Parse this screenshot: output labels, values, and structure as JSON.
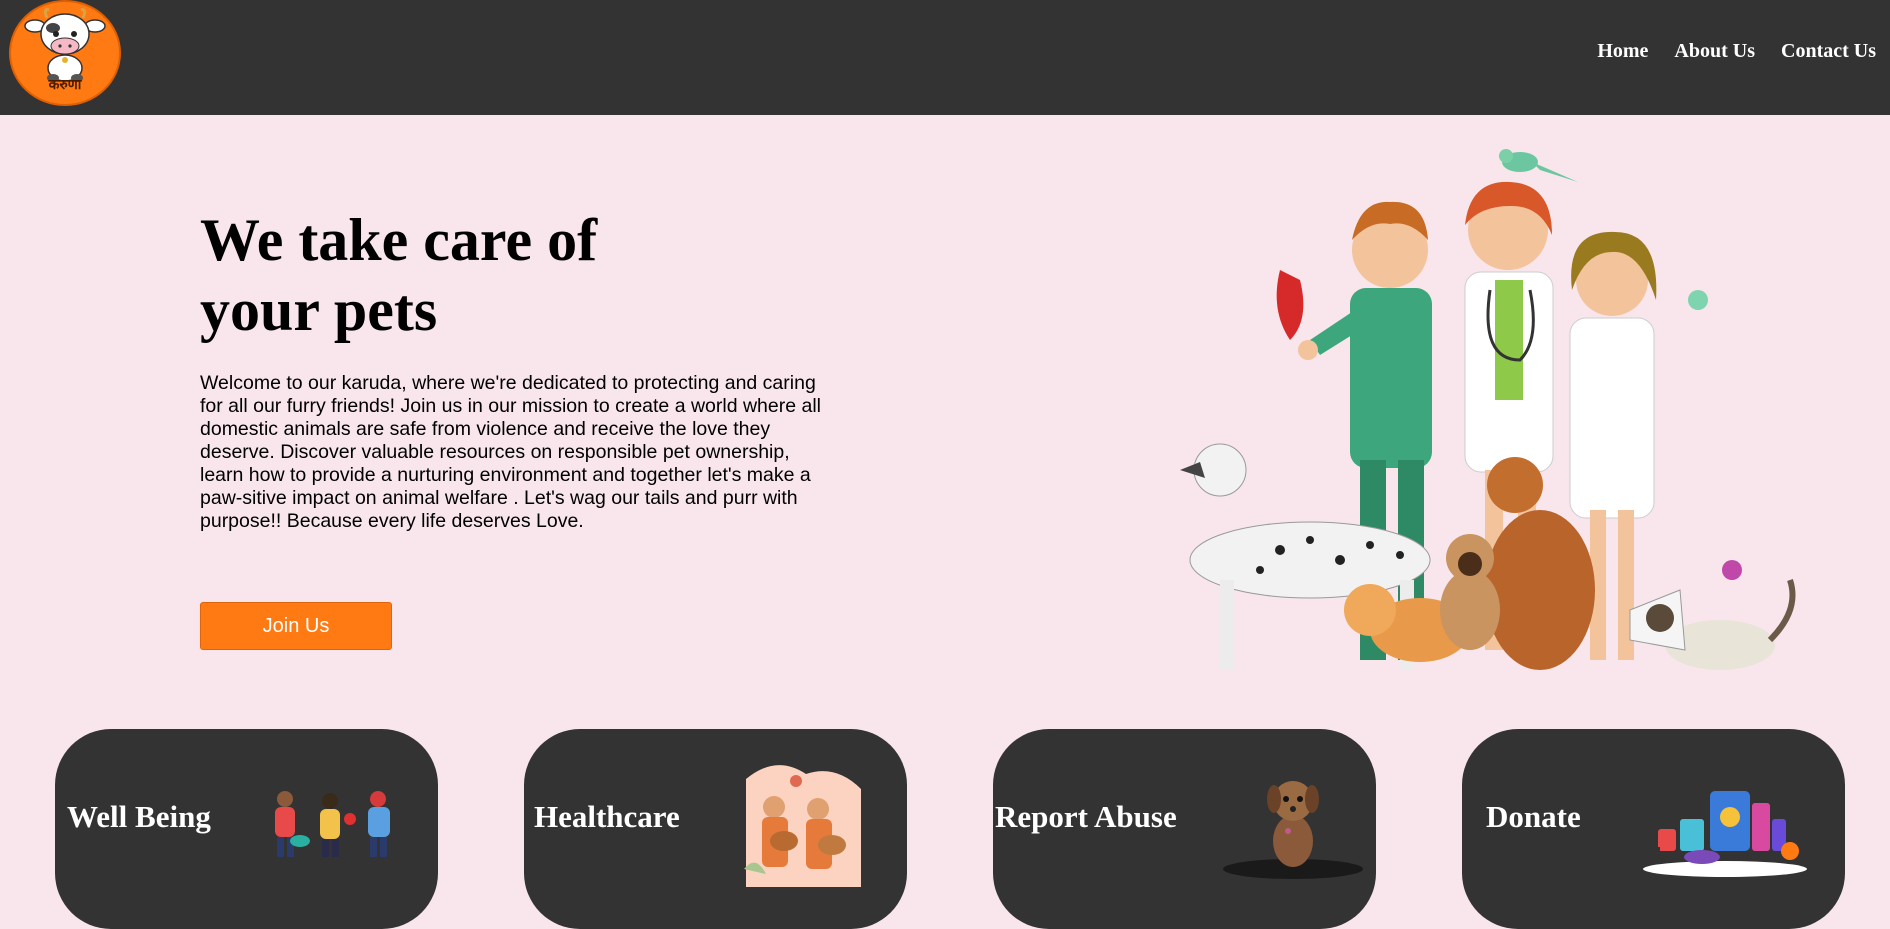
{
  "brand": {
    "logo_text": "करुणा",
    "accent": "#ff7a12",
    "dark": "#333333",
    "background": "#f8e6ec"
  },
  "nav": {
    "items": [
      "Home",
      "About Us",
      "Contact Us"
    ]
  },
  "hero": {
    "title": "We take care of your pets",
    "description": "Welcome to our karuda, where we're dedicated to protecting and caring for all our furry friends! Join us in our mission to create a world where all domestic animals are safe from violence and receive the love they deserve. Discover valuable resources on responsible pet ownership, learn how to provide a nurturing environment and together let's make a paw-sitive impact on animal welfare . Let's wag our tails and purr with purpose!! Because every life deserves Love.",
    "button_label": "Join Us"
  },
  "cards": [
    {
      "title": "Well Being",
      "icon": "people-with-pets-icon"
    },
    {
      "title": "Healthcare",
      "icon": "vets-with-dogs-icon"
    },
    {
      "title": "Report Abuse",
      "icon": "sad-puppy-icon"
    },
    {
      "title": "Donate",
      "icon": "pet-supplies-icon"
    }
  ]
}
